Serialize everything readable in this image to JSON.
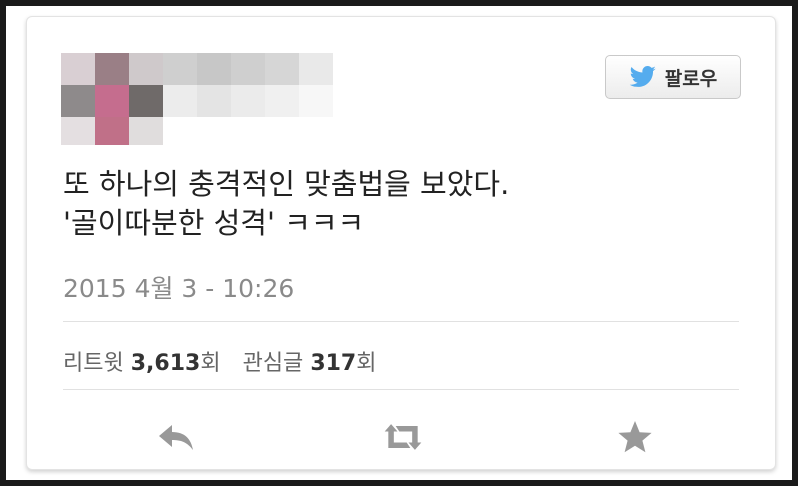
{
  "follow_button": {
    "label": "팔로우",
    "icon": "twitter-bird-icon"
  },
  "tweet": {
    "lines": [
      "또 하나의 충격적인 맞춤법을 보았다.",
      "'골이따분한 성격' ㅋㅋㅋ"
    ],
    "timestamp": "2015 4월 3 - 10:26"
  },
  "stats": {
    "retweets_label": "리트윗",
    "retweets_value": "3,613",
    "retweets_unit": "회",
    "favorites_label": "관심글",
    "favorites_value": "317",
    "favorites_unit": "회"
  },
  "actions": {
    "reply_icon": "reply-icon",
    "retweet_icon": "retweet-icon",
    "favorite_icon": "star-icon"
  },
  "colors": {
    "twitter_blue": "#55acee",
    "action_gray": "#999999",
    "avatar_pink": "#c56d8e"
  }
}
